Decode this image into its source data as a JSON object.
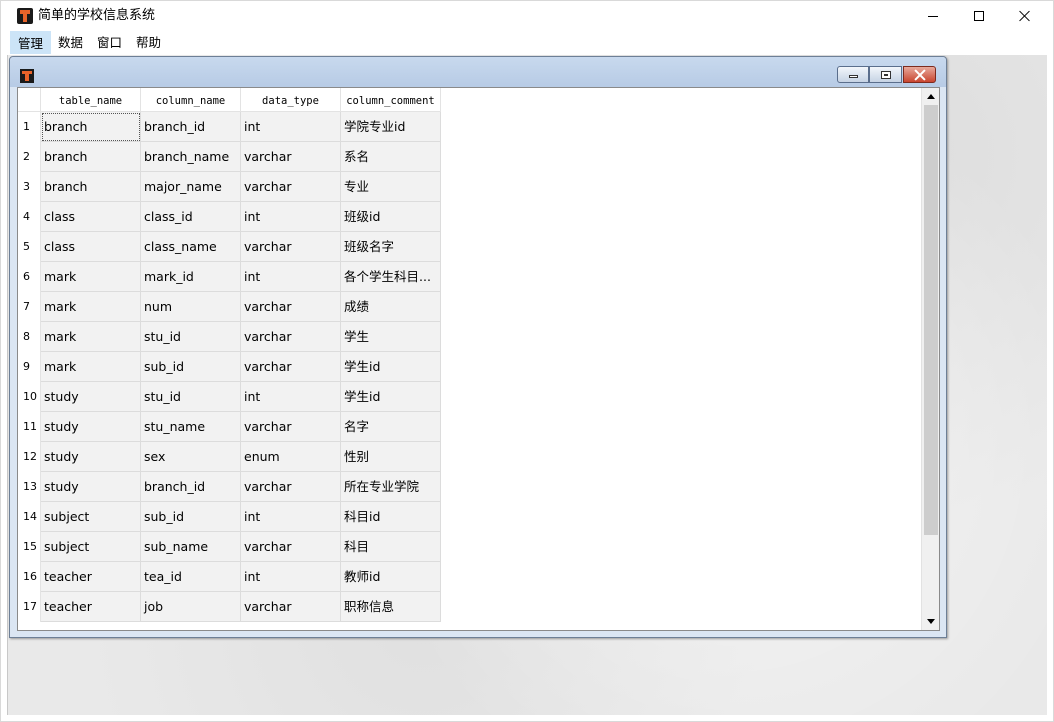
{
  "window": {
    "title": "简单的学校信息系统",
    "controls": {
      "minimize": "minimize",
      "maximize": "maximize",
      "close": "close"
    }
  },
  "menu": {
    "items": [
      {
        "label": "管理",
        "active": true
      },
      {
        "label": "数据",
        "active": false
      },
      {
        "label": "窗口",
        "active": false
      },
      {
        "label": "帮助",
        "active": false
      }
    ]
  },
  "child_window": {
    "icon": "app-icon"
  },
  "table": {
    "columns": [
      "table_name",
      "column_name",
      "data_type",
      "column_comment"
    ],
    "rows": [
      {
        "num": "1",
        "table_name": "branch",
        "column_name": "branch_id",
        "data_type": "int",
        "column_comment": "学院专业id"
      },
      {
        "num": "2",
        "table_name": "branch",
        "column_name": "branch_name",
        "data_type": "varchar",
        "column_comment": "系名"
      },
      {
        "num": "3",
        "table_name": "branch",
        "column_name": "major_name",
        "data_type": "varchar",
        "column_comment": "专业"
      },
      {
        "num": "4",
        "table_name": "class",
        "column_name": "class_id",
        "data_type": "int",
        "column_comment": "班级id"
      },
      {
        "num": "5",
        "table_name": "class",
        "column_name": "class_name",
        "data_type": "varchar",
        "column_comment": "班级名字"
      },
      {
        "num": "6",
        "table_name": "mark",
        "column_name": "mark_id",
        "data_type": "int",
        "column_comment": "各个学生科目..."
      },
      {
        "num": "7",
        "table_name": "mark",
        "column_name": "num",
        "data_type": "varchar",
        "column_comment": "成绩"
      },
      {
        "num": "8",
        "table_name": "mark",
        "column_name": "stu_id",
        "data_type": "varchar",
        "column_comment": "学生"
      },
      {
        "num": "9",
        "table_name": "mark",
        "column_name": "sub_id",
        "data_type": "varchar",
        "column_comment": "学生id"
      },
      {
        "num": "10",
        "table_name": "study",
        "column_name": "stu_id",
        "data_type": "int",
        "column_comment": "学生id"
      },
      {
        "num": "11",
        "table_name": "study",
        "column_name": "stu_name",
        "data_type": "varchar",
        "column_comment": "名字"
      },
      {
        "num": "12",
        "table_name": "study",
        "column_name": "sex",
        "data_type": "enum",
        "column_comment": "性别"
      },
      {
        "num": "13",
        "table_name": "study",
        "column_name": "branch_id",
        "data_type": "varchar",
        "column_comment": "所在专业学院"
      },
      {
        "num": "14",
        "table_name": "subject",
        "column_name": "sub_id",
        "data_type": "int",
        "column_comment": "科目id"
      },
      {
        "num": "15",
        "table_name": "subject",
        "column_name": "sub_name",
        "data_type": "varchar",
        "column_comment": "科目"
      },
      {
        "num": "16",
        "table_name": "teacher",
        "column_name": "tea_id",
        "data_type": "int",
        "column_comment": "教师id"
      },
      {
        "num": "17",
        "table_name": "teacher",
        "column_name": "job",
        "data_type": "varchar",
        "column_comment": "职称信息"
      }
    ]
  },
  "colors": {
    "menu_active": "#cce4f7",
    "child_title": "#b7cbe5",
    "cell_bg": "#f2f2f2",
    "close_button": "#c9452f"
  }
}
